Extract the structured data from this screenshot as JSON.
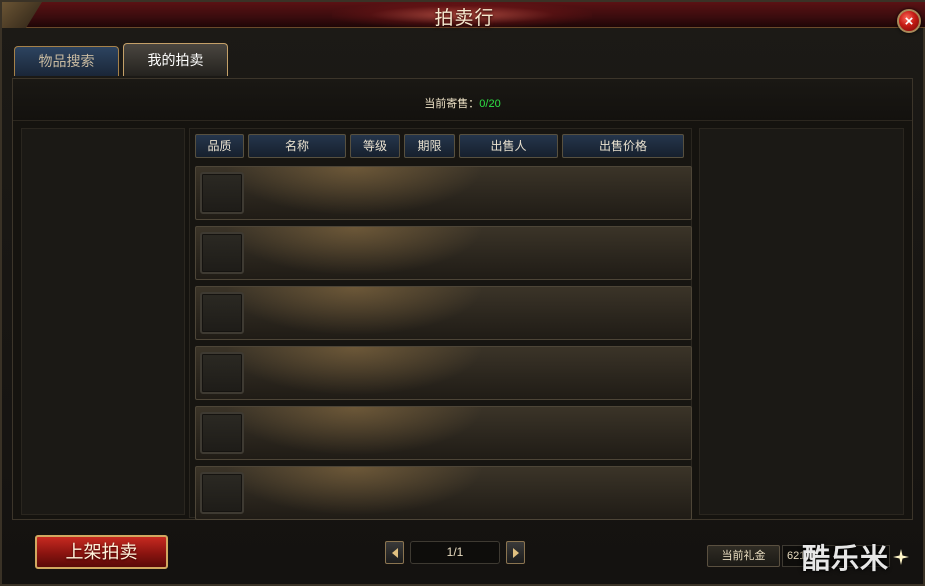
{
  "window": {
    "title": "拍卖行"
  },
  "tabs": [
    {
      "label": "物品搜索",
      "active": false
    },
    {
      "label": "我的拍卖",
      "active": true
    }
  ],
  "consignment": {
    "label": "当前寄售：",
    "count": "0/20"
  },
  "table": {
    "headers": [
      "品质",
      "名称",
      "等级",
      "期限",
      "出售人",
      "出售价格"
    ],
    "rows": [
      {},
      {},
      {},
      {},
      {},
      {}
    ]
  },
  "footer": {
    "list_button": "上架拍卖",
    "page": "1/1",
    "gold_label": "当前礼金",
    "gold_value": "62100"
  },
  "watermark": "酷乐米",
  "colors": {
    "accent": "#c4a068",
    "count_green": "#2ee044",
    "list_button": "#c72a20",
    "title_bar": "#5a1214"
  },
  "icons": [
    "close-icon",
    "prev-page-icon",
    "next-page-icon",
    "sparkle-icon"
  ]
}
